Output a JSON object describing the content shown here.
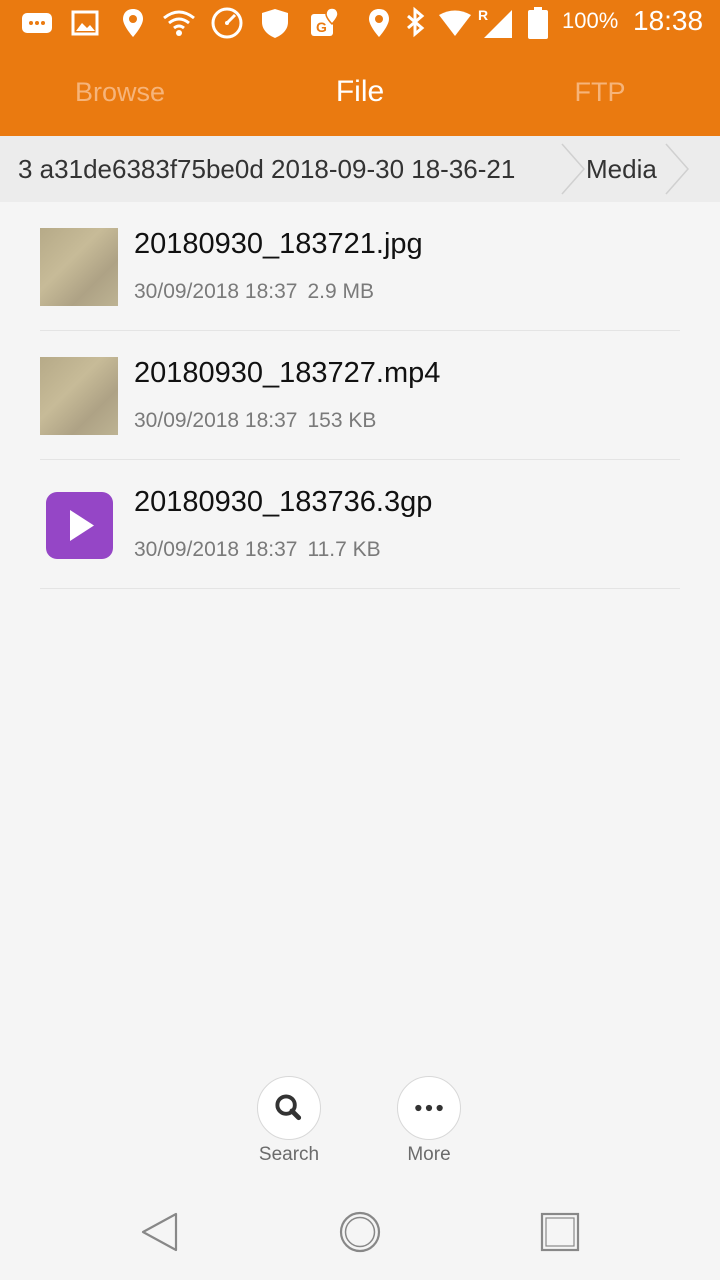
{
  "status_bar": {
    "icons": [
      "messenger-icon",
      "gallery-icon",
      "location-icon",
      "wifi-icon",
      "speedometer-icon",
      "shield-icon",
      "maps-icon",
      "location-icon",
      "bluetooth-icon",
      "wifi-signal-icon",
      "cell-signal-icon",
      "battery-icon"
    ],
    "roaming_indicator": "R",
    "battery_percent": "100%",
    "time": "18:38"
  },
  "tabs": [
    {
      "label": "Browse",
      "active": false
    },
    {
      "label": "File",
      "active": true
    },
    {
      "label": "FTP",
      "active": false
    }
  ],
  "breadcrumb": [
    {
      "label": "3 a31de6383f75be0d 2018-09-30 18-36-21"
    },
    {
      "label": "Media"
    }
  ],
  "files": [
    {
      "name": "20180930_183721.jpg",
      "date": "30/09/2018 18:37",
      "size": "2.9 MB",
      "icon": "image-thumbnail"
    },
    {
      "name": "20180930_183727.mp4",
      "date": "30/09/2018 18:37",
      "size": "153 KB",
      "icon": "video-thumbnail"
    },
    {
      "name": "20180930_183736.3gp",
      "date": "30/09/2018 18:37",
      "size": "11.7 KB",
      "icon": "play-icon"
    }
  ],
  "actions": {
    "search_label": "Search",
    "more_label": "More"
  },
  "colors": {
    "accent": "#ea7a10",
    "video_icon": "#9546c6",
    "background": "#f5f5f5"
  }
}
